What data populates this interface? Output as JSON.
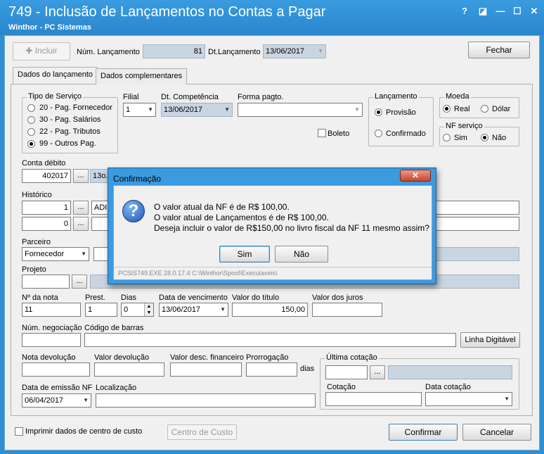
{
  "window": {
    "title": "749 - Inclusão de Lançamentos no Contas a Pagar",
    "subtitle": "Winthor - PC Sistemas",
    "buttons": [
      "?",
      "◪",
      "—",
      "☐",
      "✕"
    ]
  },
  "toolbar": {
    "incluir_label": "Incluir",
    "num_lanc_label": "Núm. Lançamento",
    "num_lanc_value": "81",
    "dt_lanc_label": "Dt.Lançamento",
    "dt_lanc_value": "13/06/2017",
    "fechar_label": "Fechar"
  },
  "tabs": [
    "Dados do lançamento",
    "Dados complementares"
  ],
  "tipo_servico": {
    "title": "Tipo de Serviço",
    "options": [
      "20 - Pag. Fornecedor",
      "30 - Pag. Salários",
      "22 - Pag. Tributos",
      "99 - Outros Pag."
    ],
    "selected": 3
  },
  "filial": {
    "label": "Filial",
    "value": "1"
  },
  "dt_competencia": {
    "label": "Dt. Competência",
    "value": "13/06/2017"
  },
  "forma_pagto": {
    "label": "Forma pagto.",
    "value": ""
  },
  "boleto": {
    "label": "Boleto",
    "checked": false
  },
  "lancamento": {
    "title": "Lançamento",
    "options": [
      "Provisão",
      "Confirmado"
    ],
    "selected": 0
  },
  "moeda": {
    "title": "Moeda",
    "options": [
      "Real",
      "Dólar"
    ],
    "selected": 0
  },
  "nf_servico": {
    "title": "NF serviço",
    "options": [
      "Sim",
      "Não"
    ],
    "selected": 1
  },
  "conta_debito": {
    "label": "Conta débito",
    "value": "402017",
    "desc": "13o."
  },
  "historico": {
    "label": "Histórico",
    "row1_value": "1",
    "row1_desc": "ADI",
    "row2_value": "0"
  },
  "parceiro": {
    "label": "Parceiro",
    "value": "Fornecedor"
  },
  "projeto": {
    "label": "Projeto"
  },
  "nota": {
    "num_label": "Nº da nota",
    "num_value": "11",
    "prest_label": "Prest.",
    "prest_value": "1",
    "dias_label": "Dias",
    "dias_value": "0",
    "venc_label": "Data de vencimento",
    "venc_value": "13/06/2017",
    "valor_label": "Valor do título",
    "valor_value": "150,00",
    "juros_label": "Valor dos juros",
    "juros_value": ""
  },
  "negociacao": {
    "num_label": "Núm. negociação",
    "barras_label": "Código de barras",
    "linha_label": "Linha Digitável"
  },
  "devolucao": {
    "nota_label": "Nota devolução",
    "valor_label": "Valor devolução",
    "desc_label": "Valor desc. financeiro",
    "prorrog_label": "Prorrogação",
    "dias_label": "dias"
  },
  "ultima_cotacao": {
    "title": "Última cotação",
    "cotacao_label": "Cotação",
    "data_label": "Data cotação"
  },
  "emissao": {
    "label": "Data de emissão NF",
    "value": "06/04/2017",
    "local_label": "Localização"
  },
  "footer": {
    "imprimir_label": "Imprimir dados de centro de custo",
    "centro_label": "Centro de Custo",
    "confirmar_label": "Confirmar",
    "cancelar_label": "Cancelar"
  },
  "dialog": {
    "title": "Confirmação",
    "line1": "O valor atual da NF é de R$ 100,00.",
    "line2": "O valor atual de Lançamentos é de R$ 100,00.",
    "line3": "Deseja incluir o valor de R$150,00 no livro fiscal da NF 11 mesmo assim?",
    "sim_label": "Sim",
    "nao_label": "Não",
    "status": "PCSIS749.EXE 28.0.17.4 C:\\Winthor\\Spool\\Executaveis\\"
  }
}
